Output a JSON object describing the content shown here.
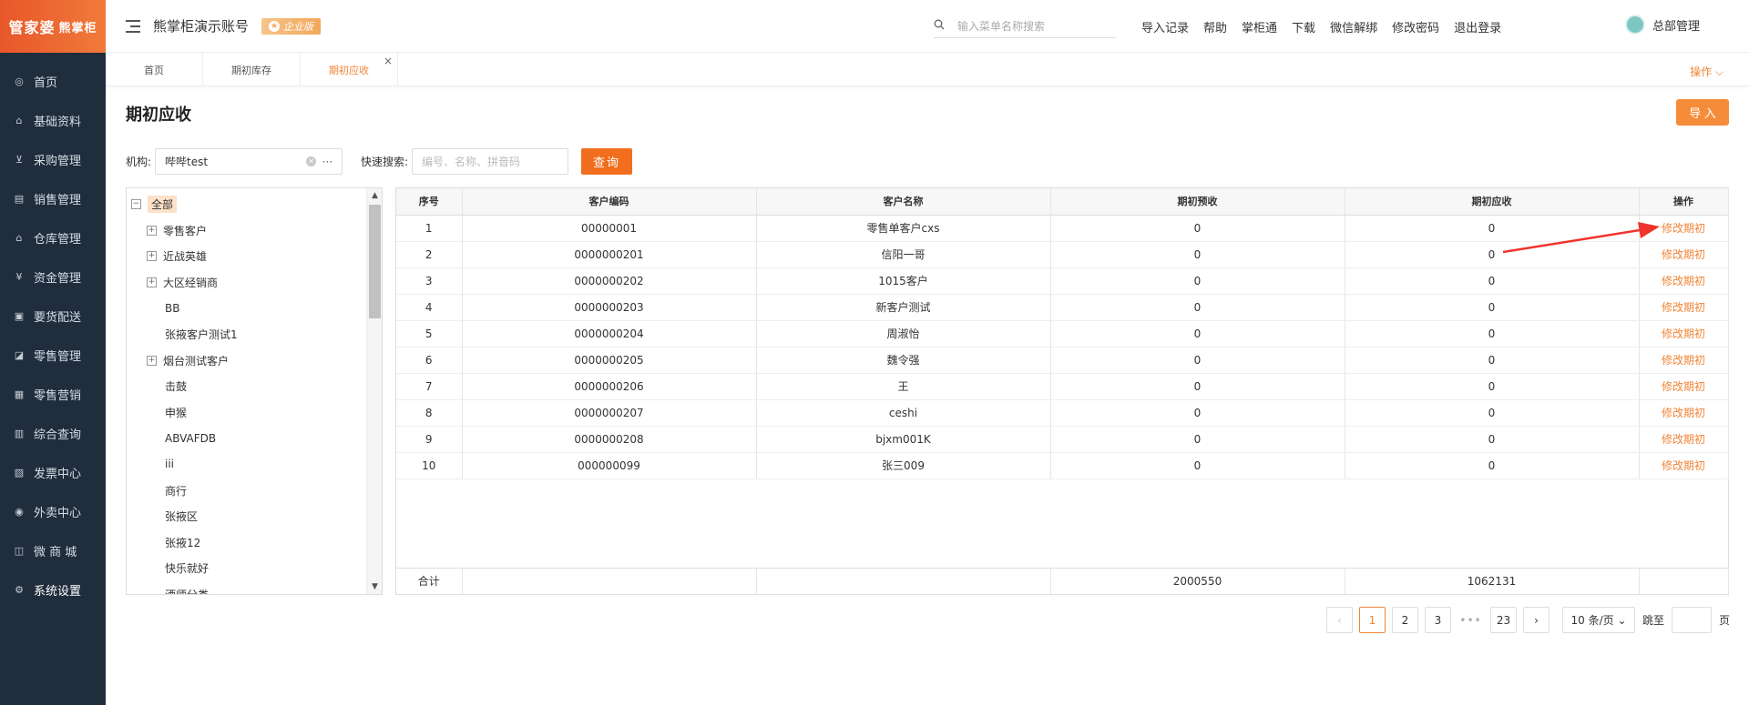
{
  "brand": {
    "name": "管家婆",
    "sub": "熊掌柜"
  },
  "sidebar": {
    "items": [
      {
        "label": "首页",
        "icon": "globe-icon"
      },
      {
        "label": "基础资料",
        "icon": "home-icon"
      },
      {
        "label": "采购管理",
        "icon": "cart-icon"
      },
      {
        "label": "销售管理",
        "icon": "sales-icon"
      },
      {
        "label": "仓库管理",
        "icon": "warehouse-icon"
      },
      {
        "label": "资金管理",
        "icon": "money-icon"
      },
      {
        "label": "要货配送",
        "icon": "delivery-icon"
      },
      {
        "label": "零售管理",
        "icon": "chart-icon"
      },
      {
        "label": "零售营销",
        "icon": "gift-icon"
      },
      {
        "label": "综合查询",
        "icon": "bar-chart-icon"
      },
      {
        "label": "发票中心",
        "icon": "invoice-icon"
      },
      {
        "label": "外卖中心",
        "icon": "takeout-icon"
      },
      {
        "label": "微 商 城",
        "icon": "shop-icon"
      },
      {
        "label": "系统设置",
        "icon": "gear-icon"
      }
    ]
  },
  "header": {
    "account": "熊掌柜演示账号",
    "badge": "企业版",
    "search_placeholder": "输入菜单名称搜索",
    "links": [
      "导入记录",
      "帮助",
      "掌柜通",
      "下载",
      "微信解绑",
      "修改密码",
      "退出登录"
    ],
    "user": "总部管理"
  },
  "tabs": {
    "items": [
      "首页",
      "期初库存",
      "期初应收"
    ],
    "operations": "操作 ⌵"
  },
  "page": {
    "title": "期初应收",
    "import_label": "导 入",
    "org_label": "机构:",
    "org_value": "哔哔test",
    "quick_label": "快速搜索:",
    "quick_placeholder": "编号、名称、拼音码",
    "query_label": "查询"
  },
  "tree": {
    "root": "全部",
    "nodes": [
      {
        "label": "零售客户",
        "expandable": true
      },
      {
        "label": "近战英雄",
        "expandable": true
      },
      {
        "label": "大区经销商",
        "expandable": true
      },
      {
        "label": "BB",
        "expandable": false
      },
      {
        "label": "张掖客户测试1",
        "expandable": false
      },
      {
        "label": "烟台测试客户",
        "expandable": true
      },
      {
        "label": "击鼓",
        "expandable": false
      },
      {
        "label": "申猴",
        "expandable": false
      },
      {
        "label": "ABVAFDB",
        "expandable": false
      },
      {
        "label": "iii",
        "expandable": false
      },
      {
        "label": "商行",
        "expandable": false
      },
      {
        "label": "张掖区",
        "expandable": false
      },
      {
        "label": "张掖12",
        "expandable": false
      },
      {
        "label": "快乐就好",
        "expandable": false
      },
      {
        "label": "酒师分类",
        "expandable": false
      }
    ]
  },
  "table": {
    "columns": [
      "序号",
      "客户编码",
      "客户名称",
      "期初预收",
      "期初应收",
      "操作"
    ],
    "rows": [
      [
        "1",
        "00000001",
        "零售单客户cxs",
        "0",
        "0",
        "修改期初"
      ],
      [
        "2",
        "0000000201",
        "信阳一哥",
        "0",
        "0",
        "修改期初"
      ],
      [
        "3",
        "0000000202",
        "1015客户",
        "0",
        "0",
        "修改期初"
      ],
      [
        "4",
        "0000000203",
        "新客户测试",
        "0",
        "0",
        "修改期初"
      ],
      [
        "5",
        "0000000204",
        "周淑怡",
        "0",
        "0",
        "修改期初"
      ],
      [
        "6",
        "0000000205",
        "魏令强",
        "0",
        "0",
        "修改期初"
      ],
      [
        "7",
        "0000000206",
        "王",
        "0",
        "0",
        "修改期初"
      ],
      [
        "8",
        "0000000207",
        "ceshi",
        "0",
        "0",
        "修改期初"
      ],
      [
        "9",
        "0000000208",
        "bjxm001K",
        "0",
        "0",
        "修改期初"
      ],
      [
        "10",
        "000000099",
        "张三009",
        "0",
        "0",
        "修改期初"
      ]
    ],
    "totals": [
      "合计",
      "",
      "",
      "2000550",
      "1062131",
      ""
    ]
  },
  "pagination": {
    "pages": [
      "1",
      "2",
      "3",
      "23"
    ],
    "ellipsis": "•••",
    "current": "1",
    "page_size": "10 条/页",
    "jump_label": "跳至",
    "page_suffix": "页"
  },
  "annotation": {
    "color": "#f0332b"
  },
  "colors": {
    "accent": "#f08536",
    "sidebar": "#1f2d3d",
    "query": "#f06e1e"
  }
}
